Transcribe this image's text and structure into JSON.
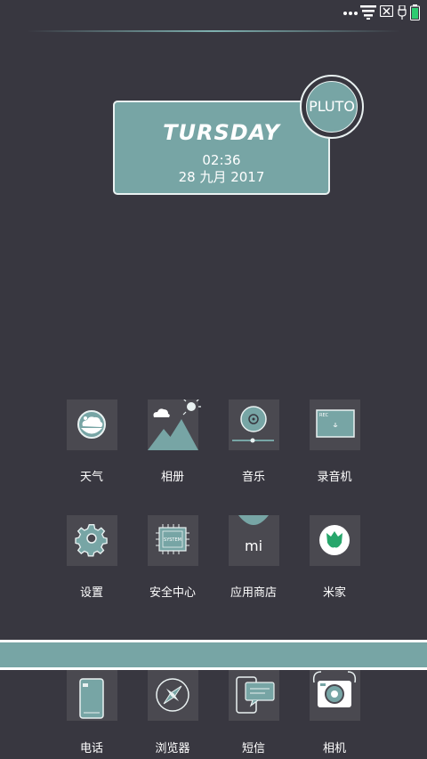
{
  "status_bar": {
    "icons": [
      "more-dots-icon",
      "wifi-icon",
      "no-sim-icon",
      "usb-icon",
      "battery-icon"
    ]
  },
  "widget": {
    "day": "TURSDAY",
    "time": "02:36",
    "date": "28 九月 2017",
    "badge": "PLUTO"
  },
  "apps": [
    {
      "label": "天气",
      "icon": "weather-icon"
    },
    {
      "label": "相册",
      "icon": "gallery-icon"
    },
    {
      "label": "音乐",
      "icon": "music-icon"
    },
    {
      "label": "录音机",
      "icon": "recorder-icon"
    },
    {
      "label": "设置",
      "icon": "settings-gear-icon"
    },
    {
      "label": "安全中心",
      "icon": "security-chip-icon"
    },
    {
      "label": "应用商店",
      "icon": "mi-store-icon"
    },
    {
      "label": "米家",
      "icon": "mijia-icon"
    }
  ],
  "chip_text": "SYSTEM",
  "store_text": "mi",
  "dock": [
    {
      "label": "电话",
      "icon": "phone-icon"
    },
    {
      "label": "浏览器",
      "icon": "browser-compass-icon"
    },
    {
      "label": "短信",
      "icon": "messages-icon"
    },
    {
      "label": "相机",
      "icon": "camera-icon"
    }
  ],
  "colors": {
    "background": "#383740",
    "accent": "#77a5a5",
    "tile": "#4a4950"
  }
}
